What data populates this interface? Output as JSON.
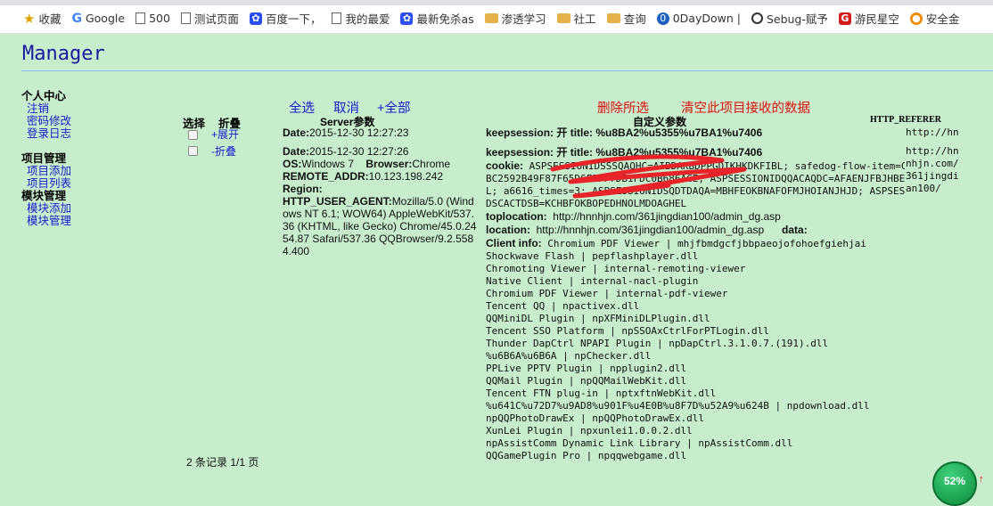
{
  "bookmarks": [
    {
      "label": "收藏",
      "icon": "star-icon"
    },
    {
      "label": "Google",
      "icon": "google-icon"
    },
    {
      "label": "500",
      "icon": "page-icon"
    },
    {
      "label": "测试页面",
      "icon": "page-icon"
    },
    {
      "label": "百度一下，",
      "icon": "baidu-paw-icon"
    },
    {
      "label": "我的最爱",
      "icon": "page-icon"
    },
    {
      "label": "最新免杀as",
      "icon": "baidu-paw-icon"
    },
    {
      "label": "渗透学习",
      "icon": "folder-icon"
    },
    {
      "label": "社工",
      "icon": "folder-icon"
    },
    {
      "label": "查询",
      "icon": "folder-icon"
    },
    {
      "label": "0DayDown |",
      "icon": "zeroday-icon"
    },
    {
      "label": "Sebug-赋予",
      "icon": "sebug-icon"
    },
    {
      "label": "游民星空",
      "icon": "gamersky-icon"
    },
    {
      "label": "安全金",
      "icon": "person-icon"
    }
  ],
  "title": "Manager",
  "sidebar": {
    "sections": [
      {
        "head": "个人中心",
        "items": [
          "注销",
          "密码修改",
          "登录日志"
        ]
      },
      {
        "head": "项目管理",
        "items": [
          "项目添加",
          "项目列表"
        ]
      },
      {
        "head": "模块管理",
        "items": [
          "模块添加",
          "模块管理"
        ]
      }
    ]
  },
  "actions": {
    "select_all": "全选",
    "cancel": "取消",
    "add_all": "+全部",
    "delete_selected": "删除所选",
    "clear_all": "清空此项目接收的数据"
  },
  "columns": {
    "select": "选择",
    "fold": "折叠",
    "server": "Server参数",
    "custom": "自定义参数",
    "referer": "HTTP_REFERER"
  },
  "rows": [
    {
      "fold": "+展开"
    },
    {
      "fold": "-折叠"
    }
  ],
  "server": {
    "row1_date": "2015-12-30 12:27:23",
    "row2_date": "2015-12-30 12:27:26",
    "os": "Windows 7",
    "browser": "Chrome",
    "remote_addr": "10.123.198.242",
    "region": "",
    "user_agent": "Mozilla/5.0 (Windows NT 6.1; WOW64) AppleWebKit/537.36 (KHTML, like Gecko) Chrome/45.0.2454.87 Safari/537.36 QQBrowser/9.2.5584.400",
    "labels": {
      "date": "Date:",
      "os": "OS:",
      "browser": "Browser:",
      "remote_addr": "REMOTE_ADDR:",
      "region": "Region:",
      "user_agent": "HTTP_USER_AGENT:"
    }
  },
  "custom": {
    "keepsession1": "keepsession: 开   title:  %u8BA2%u5355%u7BA1%u7406",
    "keepsession2": "keepsession: 开   title:  %u8BA2%u5355%u7BA1%u7406",
    "cookie_label": "cookie:",
    "cookie_1": "ASPSESSIONIDSSSQAQHC=AIBDAKBDPPGDIKHKDKFIBL; safedog-flow-item=C0",
    "cookie_2": "BC2592B49F87F65D6FFFF7DB1FDC0B686ACE; ASPSESSIONIDQQACAQDC=AFAENJFBJHBEOCEAICDJHJH",
    "cookie_3": "L; a6616_times=3; ASPSESSIONIDSQDTDAQA=MBHFEOKBNAFOFMJHOIANJHJD; ASPSESSIONI",
    "cookie_4": "DSCACTDSB=KCHBFOKBOPEDHNOLMDOAGHEL",
    "toplocation_label": "toplocation:",
    "toplocation": "http://hnnhjn.com/361jingdian100/admin_dg.asp",
    "location_label": "location:",
    "location": "http://hnnhjn.com/361jingdian100/admin_dg.asp",
    "data_label": "data:",
    "clientinfo_label": "Client info:",
    "plugins": [
      "Chromium PDF Viewer | mhjfbmdgcfjbbpaeojofohoefgiehjai",
      "Shockwave Flash | pepflashplayer.dll",
      "Chromoting Viewer | internal-remoting-viewer",
      "Native Client | internal-nacl-plugin",
      "Chromium PDF Viewer | internal-pdf-viewer",
      "Tencent QQ | npactivex.dll",
      "QQMiniDL Plugin | npXFMiniDLPlugin.dll",
      "Tencent SSO Platform | npSSOAxCtrlForPTLogin.dll",
      "Thunder DapCtrl NPAPI Plugin | npDapCtrl.3.1.0.7.(191).dll",
      "%u6B6A%u6B6A | npChecker.dll",
      "PPLive PPTV Plugin | npplugin2.dll",
      "QQMail Plugin | npQQMailWebKit.dll",
      "Tencent FTN plug-in | nptxftnWebKit.dll",
      "%u641C%u72D7%u9AD8%u901F%u4E0B%u8F7D%u52A9%u624B | npdownload.dll",
      "npQQPhotoDrawEx | npQQPhotoDrawEx.dll",
      "XunLei Plugin | npxunlei1.0.0.2.dll",
      "npAssistComm Dynamic Link Library | npAssistComm.dll",
      "QQGamePlugin Pro | npqqwebgame.dll"
    ]
  },
  "referer": {
    "row1": "http://hn",
    "row2": "http://hnnhjn.com/361jingdian100/"
  },
  "pager": "2 条记录 1/1 页",
  "status_ball": "52%",
  "status_arrow": "↑",
  "colors": {
    "background": "#c7edcc",
    "link": "#1a1ad0",
    "danger": "#e01010",
    "title": "#1a1aa0"
  }
}
